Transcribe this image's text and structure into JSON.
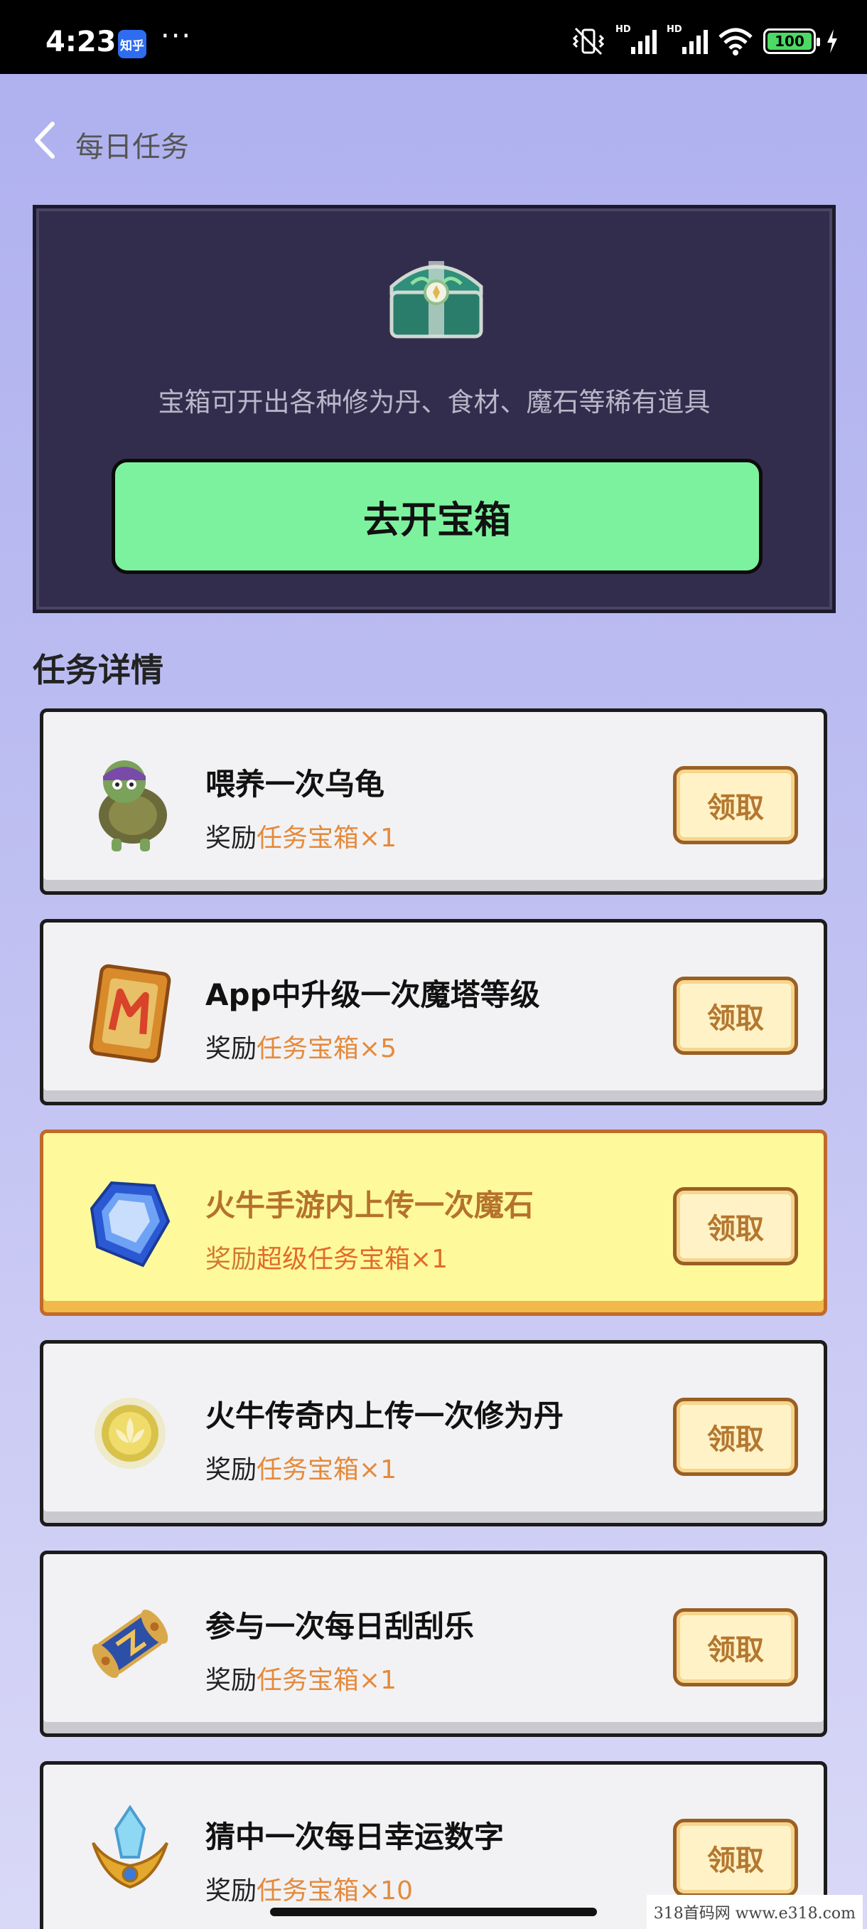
{
  "status_bar": {
    "time": "4:23",
    "app_badge": "知乎",
    "more": "···",
    "hd1": "HD",
    "hd2": "HD",
    "battery": "100"
  },
  "header": {
    "title": "每日任务"
  },
  "chest": {
    "description": "宝箱可开出各种修为丹、食材、魔石等稀有道具",
    "button_label": "去开宝箱"
  },
  "section_title": "任务详情",
  "tasks": [
    {
      "title": "喂养一次乌龟",
      "reward_prefix": "奖励",
      "reward_item": "任务宝箱×1",
      "button": "领取",
      "icon": "turtle-character-icon"
    },
    {
      "title": "App中升级一次魔塔等级",
      "reward_prefix": "奖励",
      "reward_item": "任务宝箱×5",
      "button": "领取",
      "icon": "magic-tower-card-icon"
    },
    {
      "title": "火牛手游内上传一次魔石",
      "reward_prefix": "奖励",
      "reward_item": "超级任务宝箱×1",
      "button": "领取",
      "icon": "blue-gem-icon",
      "highlighted": true
    },
    {
      "title": "火牛传奇内上传一次修为丹",
      "reward_prefix": "奖励",
      "reward_item": "任务宝箱×1",
      "button": "领取",
      "icon": "lotus-orb-icon"
    },
    {
      "title": "参与一次每日刮刮乐",
      "reward_prefix": "奖励",
      "reward_item": "任务宝箱×1",
      "button": "领取",
      "icon": "scroll-icon"
    },
    {
      "title": "猜中一次每日幸运数字",
      "reward_prefix": "奖励",
      "reward_item": "任务宝箱×10",
      "button": "领取",
      "icon": "crystal-crown-icon"
    }
  ],
  "watermark": "318首码网  www.e318.com"
}
